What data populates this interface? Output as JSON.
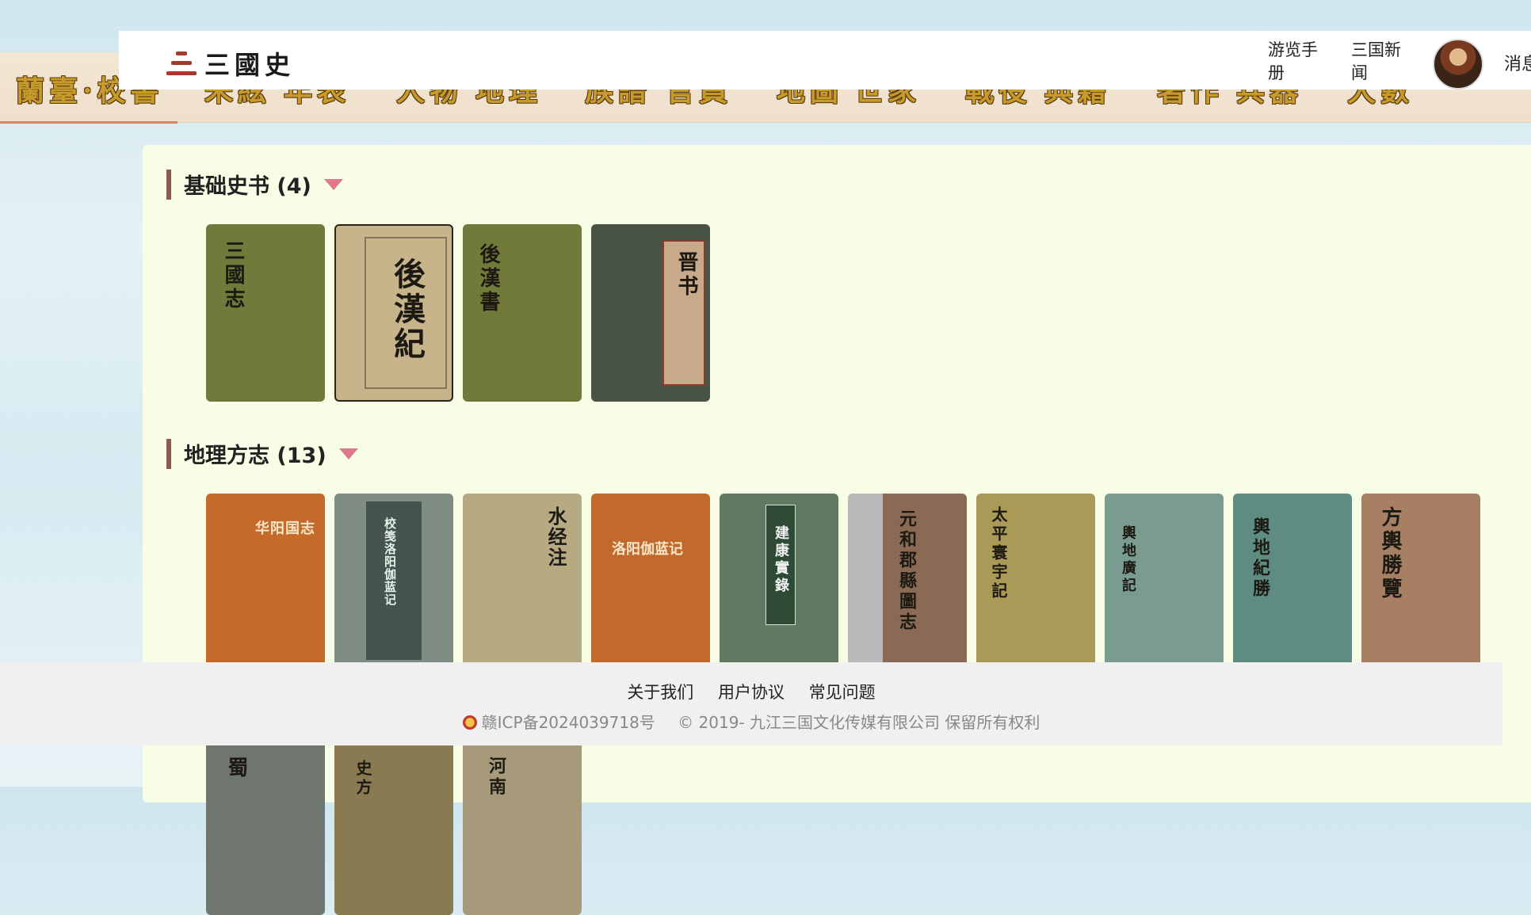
{
  "nav": {
    "items": [
      "蘭臺·校書",
      "朱絃",
      "年表",
      "人物",
      "地理",
      "族譜",
      "官員",
      "地圖",
      "世家",
      "戰役",
      "典籍",
      "著作",
      "兵器",
      "大數"
    ]
  },
  "header": {
    "logo_text": "三國史",
    "link_guide": "游览手册",
    "link_news": "三国新闻",
    "messages": "消息"
  },
  "sections": [
    {
      "title": "基础史书 (4)",
      "books": [
        {
          "title": "三國志",
          "color": "#6f7a3b"
        },
        {
          "title": "後漢紀",
          "color": "#c8b48a"
        },
        {
          "title": "後漢書",
          "color": "#727a3a"
        },
        {
          "title": "晋书",
          "color": "#4a5446"
        }
      ]
    },
    {
      "title": "地理方志 (13)",
      "books": [
        {
          "title": "华阳国志",
          "color": "#c56a2a"
        },
        {
          "title": "校笺洛阳伽蓝记",
          "color": "#7e8c84"
        },
        {
          "title": "水经注",
          "color": "#b7aa82"
        },
        {
          "title": "洛阳伽蓝记",
          "color": "#c26a2d"
        },
        {
          "title": "建康實錄",
          "color": "#607a62"
        },
        {
          "title": "元和郡縣圖志",
          "color": "#8a6a55"
        },
        {
          "title": "太平寰宇記",
          "color": "#aa9a57"
        },
        {
          "title": "輿地廣記",
          "color": "#7a9c90"
        },
        {
          "title": "輿地紀勝",
          "color": "#5f8c80"
        },
        {
          "title": "方輿勝覽",
          "color": "#a77f63"
        },
        {
          "title": "蜀",
          "color": "#6f7670"
        },
        {
          "title": "史方",
          "color": "#8a7a52"
        },
        {
          "title": "河南",
          "color": "#a69a7a"
        }
      ]
    }
  ],
  "footer": {
    "about": "关于我们",
    "agreement": "用户协议",
    "faq": "常见问题",
    "icp": "赣ICP备2024039718号",
    "copyright": "© 2019- 九江三国文化传媒有限公司 保留所有权利"
  }
}
